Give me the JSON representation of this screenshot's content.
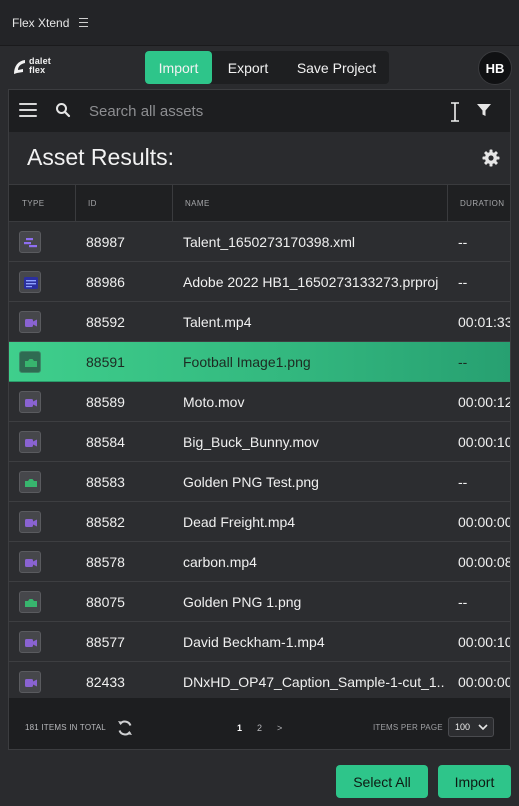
{
  "app": {
    "title": "Flex Xtend",
    "brand": "dalet flex",
    "user_initials": "HB"
  },
  "top_tabs": [
    {
      "label": "Import",
      "active": true
    },
    {
      "label": "Export",
      "active": false
    },
    {
      "label": "Save Project",
      "active": false
    }
  ],
  "search": {
    "placeholder": "Search all assets",
    "value": ""
  },
  "results": {
    "title": "Asset Results:"
  },
  "columns": {
    "type": "TYPE",
    "id": "ID",
    "name": "NAME",
    "duration": "DURATION"
  },
  "rows": [
    {
      "type_icon": "xml-icon",
      "id": "88987",
      "name": "Talent_1650273170398.xml",
      "duration": "--",
      "selected": false
    },
    {
      "type_icon": "project-icon",
      "id": "88986",
      "name": "Adobe 2022 HB1_1650273133273.prproj",
      "duration": "--",
      "selected": false
    },
    {
      "type_icon": "video-icon",
      "id": "88592",
      "name": "Talent.mp4",
      "duration": "00:01:33",
      "selected": false
    },
    {
      "type_icon": "image-icon",
      "id": "88591",
      "name": "Football Image1.png",
      "duration": "--",
      "selected": true
    },
    {
      "type_icon": "video-icon",
      "id": "88589",
      "name": "Moto.mov",
      "duration": "00:00:12",
      "selected": false
    },
    {
      "type_icon": "video-icon",
      "id": "88584",
      "name": "Big_Buck_Bunny.mov",
      "duration": "00:00:10",
      "selected": false
    },
    {
      "type_icon": "image-icon",
      "id": "88583",
      "name": "Golden PNG Test.png",
      "duration": "--",
      "selected": false
    },
    {
      "type_icon": "video-icon",
      "id": "88582",
      "name": "Dead Freight.mp4",
      "duration": "00:00:00",
      "selected": false
    },
    {
      "type_icon": "video-icon",
      "id": "88578",
      "name": "carbon.mp4",
      "duration": "00:00:08",
      "selected": false
    },
    {
      "type_icon": "image-icon",
      "id": "88075",
      "name": "Golden PNG 1.png",
      "duration": "--",
      "selected": false
    },
    {
      "type_icon": "video-icon",
      "id": "88577",
      "name": "David Beckham-1.mp4",
      "duration": "00:00:10",
      "selected": false
    },
    {
      "type_icon": "video-icon",
      "id": "82433",
      "name": "DNxHD_OP47_Caption_Sample-1-cut_1...",
      "duration": "00:00:00",
      "selected": false
    }
  ],
  "footer": {
    "total": "181 ITEMS IN TOTAL",
    "pages": [
      "1",
      "2",
      ">"
    ],
    "current_page": "1",
    "items_per_page_label": "ITEMS PER PAGE",
    "items_per_page_value": "100"
  },
  "actions": {
    "select_all": "Select All",
    "import": "Import"
  },
  "colors": {
    "accent": "#2ec58a",
    "background": "#2a2b2e",
    "panel": "#1d1e20",
    "video_icon": "#8a63d2",
    "image_icon": "#38b56e",
    "project_icon": "#2b2f9e"
  }
}
